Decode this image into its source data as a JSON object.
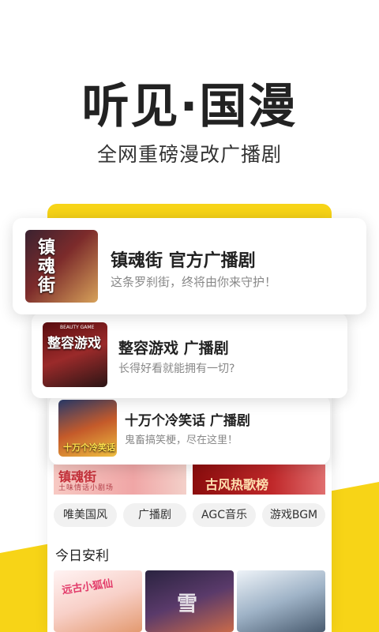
{
  "hero": {
    "title_part1": "听见·",
    "title_part2": "国漫",
    "subtitle": "全网重磅漫改广播剧"
  },
  "colors": {
    "accent": "#f7d417",
    "text_primary": "#222222",
    "text_secondary": "#888888"
  },
  "featured": [
    {
      "title": "镇魂街 官方广播剧",
      "desc": "这条罗刹街，终将由你来守护！",
      "cover_text": "镇魂街"
    },
    {
      "title": "整容游戏 广播剧",
      "desc": "长得好看就能拥有一切?",
      "cover_text": "整容游戏",
      "cover_small": "BEAUTY GAME"
    },
    {
      "title": "十万个冷笑话 广播剧",
      "desc": "鬼畜搞笑梗，尽在这里！",
      "cover_text": "十万个冷笑话"
    }
  ],
  "banners": {
    "left_title": "镇魂街",
    "left_sub": "土味情话小剧场",
    "right_title": "古风热歌榜"
  },
  "tags": [
    "唯美国风",
    "广播剧",
    "AGC音乐",
    "游戏BGM"
  ],
  "today_section": {
    "title": "今日安利",
    "thumb1_text": "远古小狐仙",
    "thumb2_text": "雪"
  }
}
